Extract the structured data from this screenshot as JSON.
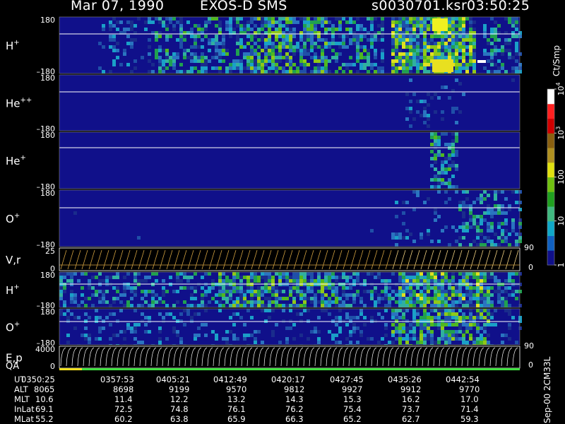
{
  "header": {
    "date": "Mar 07, 1990",
    "instrument": "EXOS-D SMS",
    "file": "s0030701.ksr",
    "time": "03:50:25"
  },
  "colorbar": {
    "label": "Ct/Smp",
    "ticks": [
      {
        "value": 10000,
        "label": "10",
        "sup": "4"
      },
      {
        "value": 1000,
        "label": "10",
        "sup": "3"
      },
      {
        "value": 100,
        "label": "100"
      },
      {
        "value": 10,
        "label": "10"
      },
      {
        "value": 1,
        "label": "1"
      }
    ],
    "colors": [
      "#10108a",
      "#1060c0",
      "#10a8c8",
      "#40b880",
      "#20a020",
      "#70c010",
      "#e0e010",
      "#b09020",
      "#8a6010",
      "#d00000",
      "#ff2020",
      "#ffffff"
    ]
  },
  "panels": [
    {
      "id": "h-plus-top",
      "name": "H",
      "sup": "+",
      "ytop": "180",
      "ybot": "–180"
    },
    {
      "id": "he-plusplus",
      "name": "He",
      "sup": "++",
      "ytop": "180",
      "ybot": "–180"
    },
    {
      "id": "he-plus",
      "name": "He",
      "sup": "+",
      "ytop": "180",
      "ybot": "–180"
    },
    {
      "id": "o-plus-top",
      "name": "O",
      "sup": "+",
      "ytop": "180",
      "ybot": "–180"
    },
    {
      "id": "vr",
      "name": "V,r",
      "sup": "",
      "ytop": "25",
      "ybot": "0",
      "rtop": "90",
      "rbot": "0"
    },
    {
      "id": "h-plus-low",
      "name": "H",
      "sup": "+",
      "ytop": "180",
      "ybot": "–180"
    },
    {
      "id": "o-plus-low",
      "name": "O",
      "sup": "+",
      "ytop": "180",
      "ybot": "–180"
    },
    {
      "id": "ep",
      "name": "E,p",
      "sup": "",
      "ytop": "4000",
      "ybot": "0",
      "rtop": "90",
      "rbot": "0"
    }
  ],
  "qa_label": "QA",
  "ephemeris": {
    "rows": [
      {
        "label": "UT",
        "values": [
          "0350:25",
          "0357:53",
          "0405:21",
          "0412:49",
          "0420:17",
          "0427:45",
          "0435:26",
          "0442:54"
        ]
      },
      {
        "label": "ALT",
        "values": [
          "8065",
          "8698",
          "9199",
          "9570",
          "9812",
          "9927",
          "9912",
          "9770"
        ]
      },
      {
        "label": "MLT",
        "values": [
          "10.6",
          "11.4",
          "12.2",
          "13.2",
          "14.3",
          "15.3",
          "16.2",
          "17.0"
        ]
      },
      {
        "label": "InLat",
        "values": [
          "69.1",
          "72.5",
          "74.8",
          "76.1",
          "76.2",
          "75.4",
          "73.7",
          "71.4"
        ]
      },
      {
        "label": "MLat",
        "values": [
          "55.2",
          "60.2",
          "63.8",
          "65.9",
          "66.3",
          "65.2",
          "62.7",
          "59.3"
        ]
      }
    ]
  },
  "side_label": "Sep-00  2CM33L",
  "chart_data": {
    "type": "heatmap",
    "title": "Mar 07, 1990   EXOS-D SMS",
    "x_tick_labels": [
      "0350:25",
      "0357:53",
      "0405:21",
      "0412:49",
      "0420:17",
      "0427:45",
      "0435:26",
      "0442:54"
    ],
    "colorbar_range": [
      1,
      10000
    ],
    "colorbar_scale": "log",
    "colorbar_unit": "Ct/Smp",
    "panels": [
      {
        "species": "H+",
        "y_range": [
          -180,
          180
        ]
      },
      {
        "species": "He++",
        "y_range": [
          -180,
          180
        ]
      },
      {
        "species": "He+",
        "y_range": [
          -180,
          180
        ]
      },
      {
        "species": "O+",
        "y_range": [
          -180,
          180
        ]
      },
      {
        "species": "V,r",
        "y_range": [
          0,
          25
        ],
        "y2_range": [
          0,
          90
        ]
      },
      {
        "species": "H+",
        "y_range": [
          -180,
          180
        ]
      },
      {
        "species": "O+",
        "y_range": [
          -180,
          180
        ]
      },
      {
        "species": "E,p",
        "y_range": [
          0,
          4000
        ],
        "y2_range": [
          0,
          90
        ]
      }
    ]
  }
}
